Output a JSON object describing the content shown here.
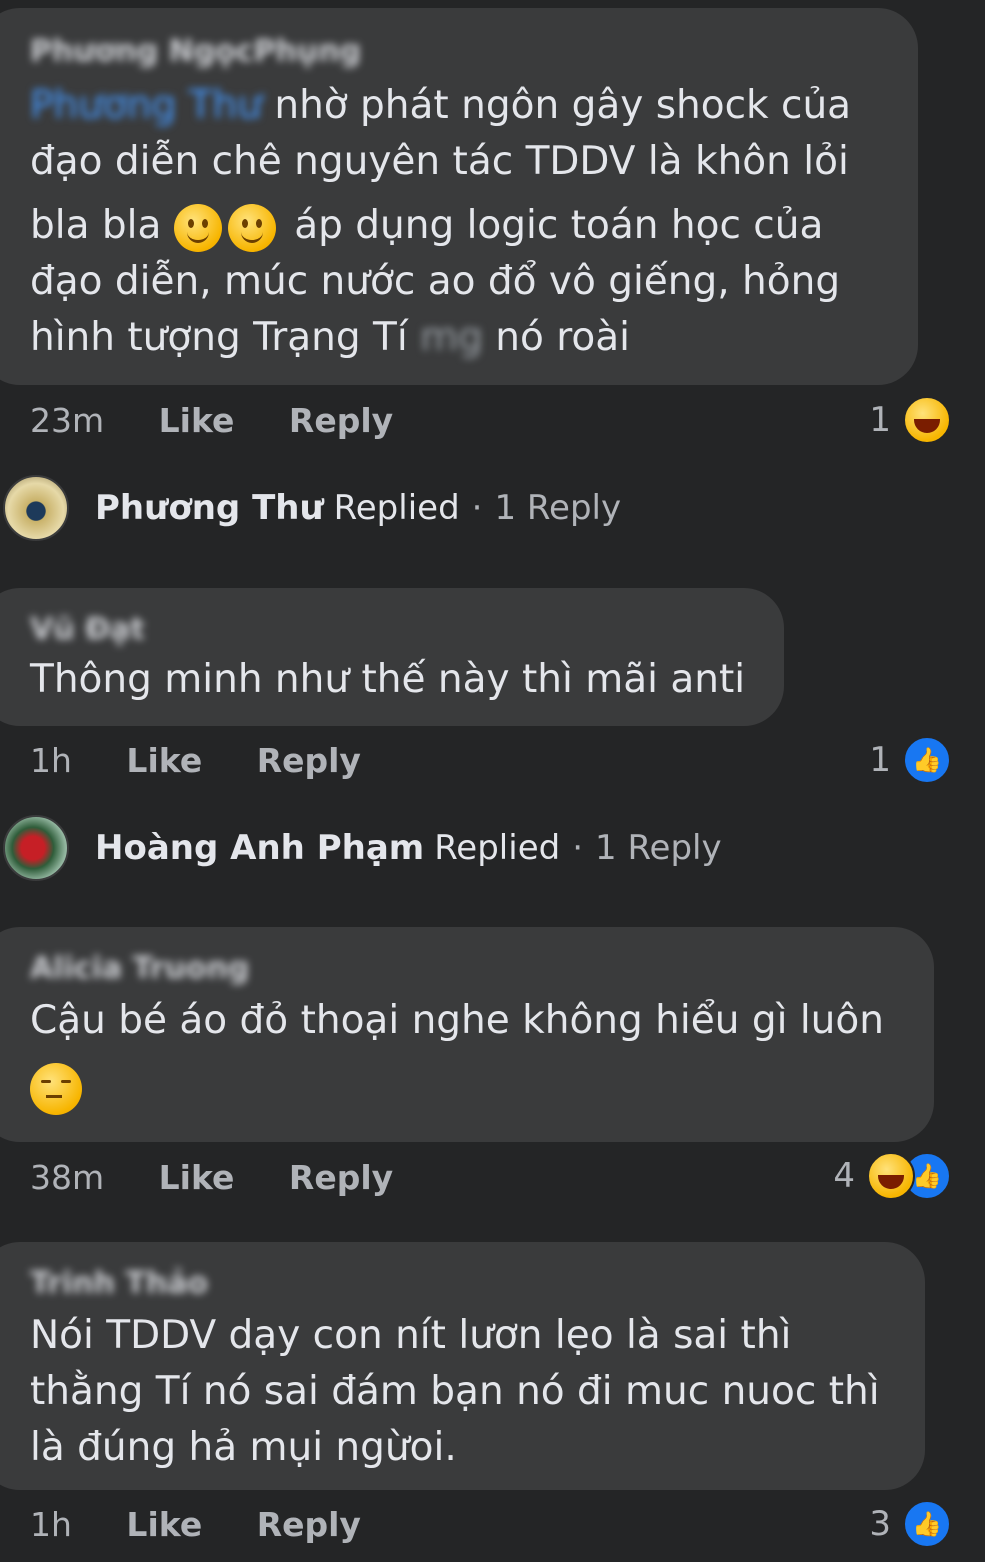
{
  "comments": [
    {
      "author": "Phương NgọcPhụng",
      "mention": "Phương Thư",
      "lines": [
        "nhờ phát ngôn gây shock của",
        "đạo diễn chê nguyên tác TDDV là khôn lỏi",
        "áp dụng logic toán học của",
        "đạo diễn, múc nước ao đổ vô giếng, hỏng",
        "hình tượng Trạng Tí",
        "nó roài"
      ],
      "line3_prefix": "bla bla",
      "blurred_word": "mg",
      "time": "23m",
      "like": "Like",
      "reply": "Reply",
      "reaction_count": "1",
      "reactions": [
        "haha"
      ]
    },
    {
      "author": "Vũ Đạt",
      "lines": [
        "Thông minh như thế này thì mãi anti"
      ],
      "time": "1h",
      "like": "Like",
      "reply": "Reply",
      "reaction_count": "1",
      "reactions": [
        "like"
      ]
    },
    {
      "author": "Alicia Truong",
      "lines": [
        "Cậu bé áo đỏ thoại nghe không hiểu gì luôn"
      ],
      "time": "38m",
      "like": "Like",
      "reply": "Reply",
      "reaction_count": "4",
      "reactions": [
        "haha",
        "like"
      ]
    },
    {
      "author": "Trinh Thảo",
      "lines": [
        "Nói TDDV dạy con nít lươn lẹo là sai thì",
        "thằng Tí nó sai đám bạn nó đi muc nuoc thì",
        "là đúng hả mụi ngừoi."
      ],
      "time": "1h",
      "like": "Like",
      "reply": "Reply",
      "reaction_count": "3",
      "reactions": [
        "like"
      ]
    }
  ],
  "replies": [
    {
      "name": "Phương Thư",
      "text": "Replied",
      "dot": "·",
      "count": "1 Reply"
    },
    {
      "name": "Hoàng Anh Phạm",
      "text": "Replied",
      "dot": "·",
      "count": "1 Reply"
    }
  ],
  "icons": {
    "like": "thumbs-up-icon",
    "haha": "laughing-face-icon",
    "smile": "slightly-smiling-face-icon",
    "unamused": "unamused-face-icon"
  },
  "colors": {
    "background": "#242526",
    "bubble": "#3a3b3c",
    "mention": "#4599ff",
    "like_blue": "#1877f2"
  }
}
